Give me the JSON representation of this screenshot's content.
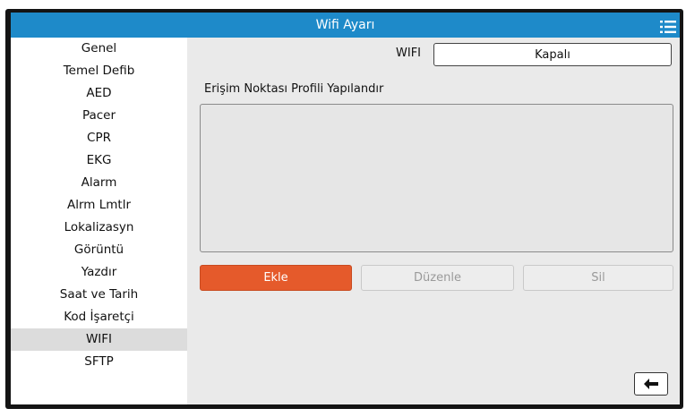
{
  "window": {
    "title": "Wifi Ayarı",
    "menu_icon": "list-menu-icon"
  },
  "sidebar": {
    "items": [
      {
        "label": "Genel"
      },
      {
        "label": "Temel Defib"
      },
      {
        "label": "AED"
      },
      {
        "label": "Pacer"
      },
      {
        "label": "CPR"
      },
      {
        "label": "EKG"
      },
      {
        "label": "Alarm"
      },
      {
        "label": "Alrm Lmtlr"
      },
      {
        "label": "Lokalizasyn"
      },
      {
        "label": "Görüntü"
      },
      {
        "label": "Yazdır"
      },
      {
        "label": "Saat ve Tarih"
      },
      {
        "label": "Kod İşaretçi"
      },
      {
        "label": "WIFI"
      },
      {
        "label": "SFTP"
      }
    ],
    "selected": "WIFI"
  },
  "wifi": {
    "label": "WIFI",
    "value": "Kapalı"
  },
  "access_point": {
    "section_label": "Erişim Noktası Profili Yapılandır",
    "profiles": []
  },
  "buttons": {
    "add_label": "Ekle",
    "edit_label": "Düzenle",
    "delete_label": "Sil",
    "back_icon": "back-arrow-icon"
  },
  "colors": {
    "title_bar": "#1e8ac9",
    "add_button": "#e55a2b",
    "selected_item": "#dcdcdc"
  }
}
